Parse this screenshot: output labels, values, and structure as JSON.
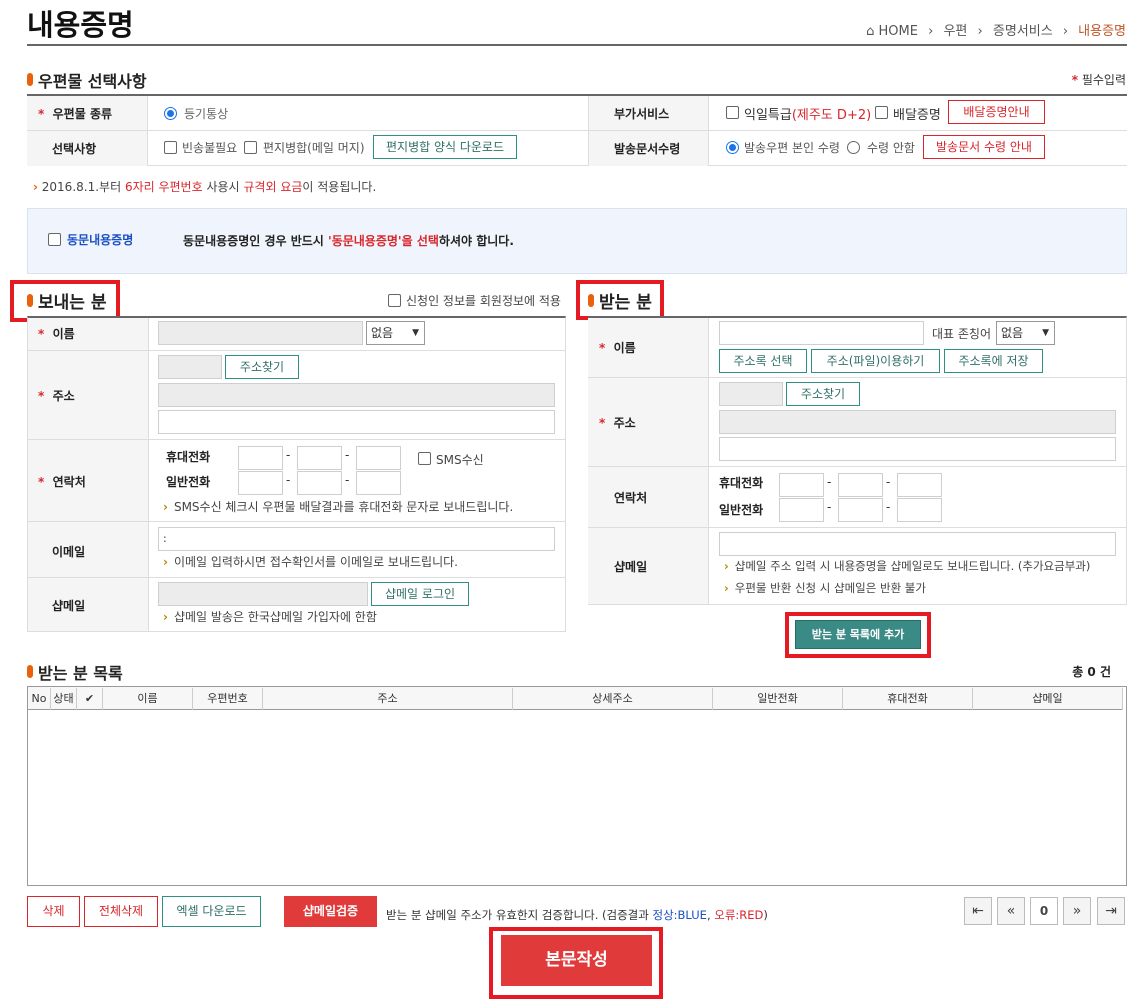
{
  "page": {
    "title": "내용증명"
  },
  "breadcrumb": {
    "home": "HOME",
    "items": [
      "우편",
      "증명서비스",
      "내용증명"
    ]
  },
  "mail_options": {
    "section_title": "우편물 선택사항",
    "required_note": "필수입력",
    "mail_type_label": "우편물 종류",
    "mail_type_value": "등기통상",
    "extra_service_label": "부가서비스",
    "next_day_label": "익일특급",
    "next_day_note": "(제주도 D+2)",
    "delivery_cert_label": "배달증명",
    "delivery_cert_guide_button": "배달증명안내",
    "options_label": "선택사항",
    "return_unneeded_label": "빈송불필요",
    "merge_label": "편지병합(메일 머지)",
    "merge_download_button": "편지병합 양식 다운로드",
    "doc_receipt_label": "발송문서수령",
    "receipt_self_label": "발송우편 본인 수령",
    "receipt_none_label": "수령 안함",
    "receipt_guide_button": "발송문서 수령 안내"
  },
  "notice": {
    "prefix": "2016.8.1.부터 ",
    "highlight1": "6자리 우편번호",
    "mid": " 사용시 ",
    "highlight2": "규격외 요금",
    "suffix": "이 적용됩니다."
  },
  "same_content": {
    "checkbox_label": "동문내용증명",
    "desc_prefix": "동문내용증명인 경우 반드시 ",
    "desc_highlight": "'동문내용증명'을 선택",
    "desc_suffix": "하셔야 합니다."
  },
  "sender": {
    "section_title": "보내는 분",
    "apply_member_label": "신청인 정보를 회원정보에 적용",
    "name_label": "이름",
    "title_select": "없음",
    "address_label": "주소",
    "address_search_button": "주소찾기",
    "contact_label": "연락처",
    "mobile_label": "휴대전화",
    "phone_label": "일반전화",
    "sms_label": "SMS수신",
    "sms_hint": "SMS수신 체크시 우편물 배달결과를 휴대전화 문자로 보내드립니다.",
    "email_label": "이메일",
    "email_value": ":",
    "email_hint": "이메일 입력하시면 접수확인서를 이메일로 보내드립니다.",
    "shopmail_label": "샵메일",
    "shopmail_login_button": "샵메일 로그인",
    "shopmail_hint": "샵메일 발송은 한국샵메일 가입자에 한함"
  },
  "receiver": {
    "section_title": "받는 분",
    "name_label": "이름",
    "honorific_label": "대표 존칭어",
    "honorific_select": "없음",
    "addressbook_select_button": "주소록 선택",
    "file_button": "주소(파일)이용하기",
    "addressbook_save_button": "주소록에 저장",
    "address_label": "주소",
    "address_search_button": "주소찾기",
    "contact_label": "연락처",
    "mobile_label": "휴대전화",
    "phone_label": "일반전화",
    "shopmail_label": "샵메일",
    "shopmail_hint1": "샵메일 주소 입력 시 내용증명을 샵메일로도 보내드립니다. (추가요금부과)",
    "shopmail_hint2": "우편물 반환 신청 시 샵메일은 반환 불가",
    "add_button": "받는 분 목록에 추가"
  },
  "receiver_list": {
    "section_title": "받는 분 목록",
    "total_prefix": "총 ",
    "total_count": "0",
    "total_suffix": " 건",
    "columns": [
      "No",
      "상태",
      "✔",
      "이름",
      "우편번호",
      "주소",
      "상세주소",
      "일반전화",
      "휴대전화",
      "샵메일"
    ],
    "rows": []
  },
  "actions": {
    "delete_button": "삭제",
    "delete_all_button": "전체삭제",
    "excel_button": "엑셀 다운로드",
    "verify_button": "샵메일검증",
    "verify_prefix": "받는 분 샵메일 주소가 유효한지 검증합니다. (검증결과 ",
    "verify_normal": "정상:BLUE",
    "verify_sep": ", ",
    "verify_error": "오류:RED",
    "verify_suffix": ")",
    "page_number": "0",
    "write_button": "본문작성"
  },
  "colors": {
    "accent_orange": "#e8620c",
    "red": "#d9262c",
    "teal": "#2f8f84",
    "highlight_box": "#e51b23"
  }
}
